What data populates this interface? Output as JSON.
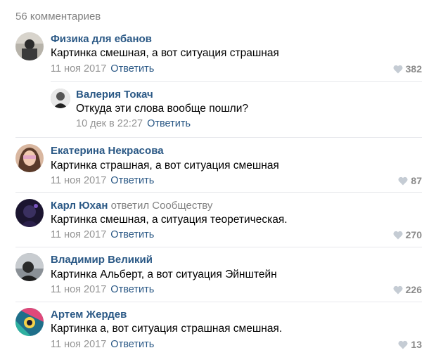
{
  "header": {
    "count_label": "56 комментариев"
  },
  "comments": [
    {
      "author": "Физика для ебанов",
      "text": "Картинка смешная, а вот ситуация страшная",
      "date": "11 ноя 2017",
      "reply": "Ответить",
      "likes": "382"
    },
    {
      "author": "Валерия Токач",
      "text": "Откуда эти слова вообще пошли?",
      "date": "10 дек в 22:27",
      "reply": "Ответить"
    },
    {
      "author": "Екатерина Некрасова",
      "text": "Картинка страшная, а вот ситуация смешная",
      "date": "11 ноя 2017",
      "reply": "Ответить",
      "likes": "87"
    },
    {
      "author": "Карл Юхан",
      "reply_to": "ответил Сообществу",
      "text": "Картинка смешная, а ситуация теоретическая.",
      "date": "11 ноя 2017",
      "reply": "Ответить",
      "likes": "270"
    },
    {
      "author": "Владимир Великий",
      "text": "Картинка Альберт, а вот ситуация Эйнштейн",
      "date": "11 ноя 2017",
      "reply": "Ответить",
      "likes": "226"
    },
    {
      "author": "Артем Жердев",
      "text": "Картинка а, вот ситуация страшная смешная.",
      "date": "11 ноя 2017",
      "reply": "Ответить",
      "likes": "13"
    }
  ],
  "colors": {
    "link": "#2a5885",
    "meta": "#939393",
    "divider": "#e7e8ec",
    "heart": "#c5ccd4"
  },
  "icons": {
    "like": "heart-icon"
  }
}
